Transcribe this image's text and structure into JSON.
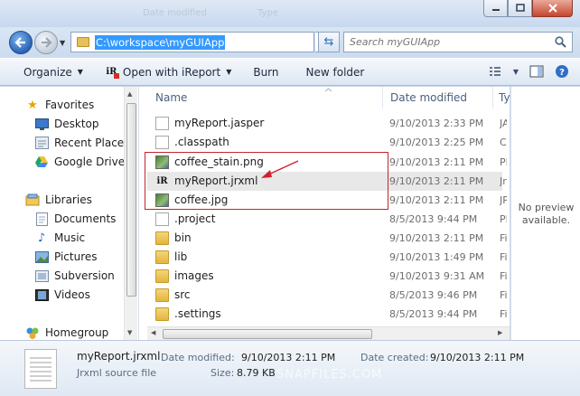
{
  "titlebar": {
    "ghost_left": "Date modified",
    "ghost_right": "Type"
  },
  "address": {
    "path": "C:\\workspace\\myGUIApp"
  },
  "search": {
    "placeholder": "Search myGUIApp"
  },
  "commands": {
    "organize": "Organize",
    "open_with": "Open with iReport",
    "burn": "Burn",
    "new_folder": "New folder"
  },
  "nav": {
    "favorites": "Favorites",
    "desktop": "Desktop",
    "recent": "Recent Places",
    "gdrive": "Google Drive",
    "libraries": "Libraries",
    "documents": "Documents",
    "music": "Music",
    "pictures": "Pictures",
    "subversion": "Subversion",
    "videos": "Videos",
    "homegroup": "Homegroup"
  },
  "columns": {
    "name": "Name",
    "date": "Date modified",
    "type": "Ty"
  },
  "files": [
    {
      "name": "myReport.jasper",
      "date": "9/10/2013 2:33 PM",
      "type": "JA",
      "icon": "document-icon"
    },
    {
      "name": ".classpath",
      "date": "9/10/2013 2:25 PM",
      "type": "CL",
      "icon": "document-icon"
    },
    {
      "name": "coffee_stain.png",
      "date": "9/10/2013 2:11 PM",
      "type": "PN",
      "icon": "image-icon"
    },
    {
      "name": "myReport.jrxml",
      "date": "9/10/2013 2:11 PM",
      "type": "Jrx",
      "icon": "ireport-icon"
    },
    {
      "name": "coffee.jpg",
      "date": "9/10/2013 2:11 PM",
      "type": "JP",
      "icon": "image-icon"
    },
    {
      "name": ".project",
      "date": "8/5/2013 9:44 PM",
      "type": "PF",
      "icon": "document-icon"
    },
    {
      "name": "bin",
      "date": "9/10/2013 2:11 PM",
      "type": "Fi",
      "icon": "folder-icon"
    },
    {
      "name": "lib",
      "date": "9/10/2013 1:49 PM",
      "type": "Fi",
      "icon": "folder-icon"
    },
    {
      "name": "images",
      "date": "9/10/2013 9:31 AM",
      "type": "Fi",
      "icon": "folder-icon"
    },
    {
      "name": "src",
      "date": "8/5/2013 9:46 PM",
      "type": "Fi",
      "icon": "folder-icon"
    },
    {
      "name": ".settings",
      "date": "8/5/2013 9:44 PM",
      "type": "Fi",
      "icon": "folder-icon"
    }
  ],
  "preview": {
    "line1": "No preview",
    "line2": "available."
  },
  "details": {
    "name": "myReport.jrxml",
    "type": "Jrxml source file",
    "modified_label": "Date modified:",
    "modified_value": "9/10/2013 2:11 PM",
    "created_label": "Date created:",
    "created_value": "9/10/2013 2:11 PM",
    "size_label": "Size:",
    "size_value": "8.79 KB",
    "watermark": "SNAPFILES.COM"
  }
}
